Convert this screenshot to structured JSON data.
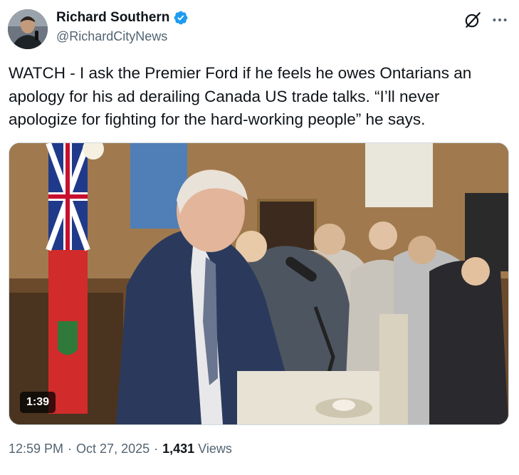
{
  "author": {
    "display_name": "Richard Southern",
    "handle": "@RichardCityNews",
    "verified": true,
    "avatar_icon": "profile-photo"
  },
  "header_icons": {
    "grok": "grok-icon",
    "more": "more-options-icon"
  },
  "tweet": {
    "text": "WATCH - I ask the Premier Ford if he feels he owes Ontarians an apology for his ad derailing Canada US trade talks. “I’ll never apologize for fighting for the hard-working people” he says."
  },
  "media": {
    "type": "video",
    "duration": "1:39"
  },
  "meta": {
    "time": "12:59 PM",
    "separator": "·",
    "date": "Oct 27, 2025",
    "views_count": "1,431",
    "views_label": "Views"
  },
  "colors": {
    "text_primary": "#0f1419",
    "text_secondary": "#536471",
    "verified_blue": "#1d9bf0"
  }
}
